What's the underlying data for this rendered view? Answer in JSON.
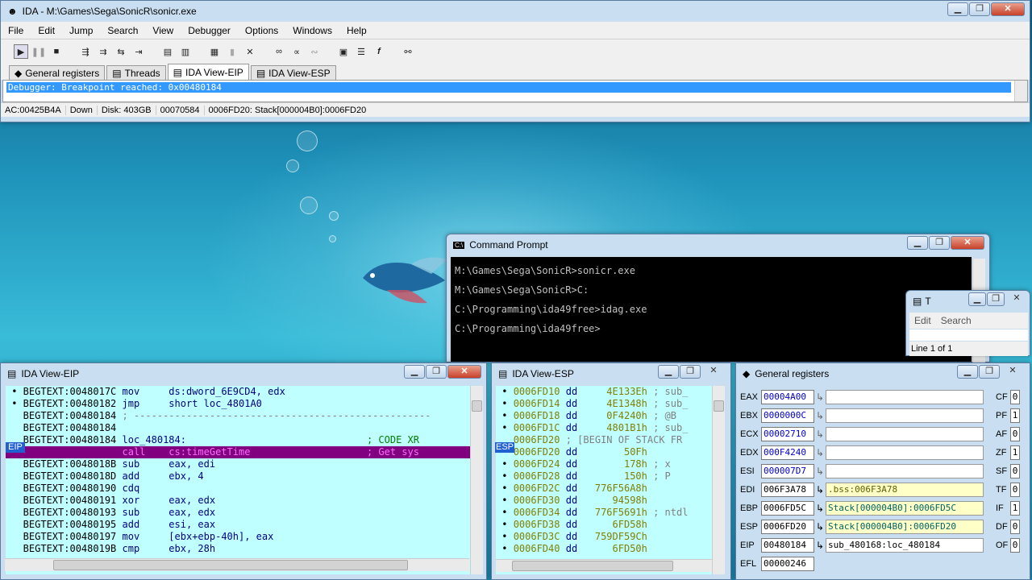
{
  "ida": {
    "title": "IDA - M:\\Games\\Sega\\SonicR\\sonicr.exe",
    "menus": [
      "File",
      "Edit",
      "Jump",
      "Search",
      "View",
      "Debugger",
      "Options",
      "Windows",
      "Help"
    ],
    "tabs": [
      "General registers",
      "Threads",
      "IDA View-EIP",
      "IDA View-ESP"
    ],
    "message": "Debugger: Breakpoint reached: 0x00480184",
    "status": [
      "AC:00425B4A",
      "Down",
      "Disk: 403GB",
      "00070584",
      "0006FD20: Stack[000004B0]:0006FD20"
    ]
  },
  "cmd": {
    "title": "Command Prompt",
    "lines": [
      "M:\\Games\\Sega\\SonicR>sonicr.exe",
      "M:\\Games\\Sega\\SonicR>C:",
      "C:\\Programming\\ida49free>idag.exe",
      "C:\\Programming\\ida49free>"
    ]
  },
  "threads": {
    "title": "T",
    "menu": [
      "Edit",
      "Search"
    ],
    "status": "Line 1 of 1"
  },
  "eip_view": {
    "title": "IDA View-EIP",
    "marker": "EIP",
    "lines": [
      {
        "addr": "BEGTEXT:0048017C",
        "mn": "mov",
        "op": "ds:dword_6E9CD4, edx",
        "cm": ""
      },
      {
        "addr": "BEGTEXT:00480182",
        "mn": "jmp",
        "op": "short loc_4801A0",
        "cm": ""
      },
      {
        "addr": "BEGTEXT:00480184",
        "mn": ";",
        "op": "---------------------------------------------------",
        "cm": ""
      },
      {
        "addr": "BEGTEXT:00480184",
        "mn": "",
        "op": "",
        "cm": ""
      },
      {
        "addr": "BEGTEXT:00480184",
        "mn": "loc_480184:",
        "op": "",
        "cm": "; CODE XR"
      },
      {
        "addr": "BEGTEXT:00480184",
        "mn": "call",
        "op": "cs:timeGetTime",
        "cm": "; Get sys"
      },
      {
        "addr": "BEGTEXT:0048018B",
        "mn": "sub",
        "op": "eax, edi",
        "cm": ""
      },
      {
        "addr": "BEGTEXT:0048018D",
        "mn": "add",
        "op": "ebx, 4",
        "cm": ""
      },
      {
        "addr": "BEGTEXT:00480190",
        "mn": "cdq",
        "op": "",
        "cm": ""
      },
      {
        "addr": "BEGTEXT:00480191",
        "mn": "xor",
        "op": "eax, edx",
        "cm": ""
      },
      {
        "addr": "BEGTEXT:00480193",
        "mn": "sub",
        "op": "eax, edx",
        "cm": ""
      },
      {
        "addr": "BEGTEXT:00480195",
        "mn": "add",
        "op": "esi, eax",
        "cm": ""
      },
      {
        "addr": "BEGTEXT:00480197",
        "mn": "mov",
        "op": "[ebx+ebp-40h], eax",
        "cm": ""
      },
      {
        "addr": "BEGTEXT:0048019B",
        "mn": "cmp",
        "op": "ebx, 28h",
        "cm": ""
      }
    ]
  },
  "esp_view": {
    "title": "IDA View-ESP",
    "marker": "ESP",
    "lines": [
      {
        "addr": "0006FD10",
        "mn": "dd",
        "val": "4E133Eh",
        "cm": "; sub_"
      },
      {
        "addr": "0006FD14",
        "mn": "dd",
        "val": "4E1348h",
        "cm": "; sub_"
      },
      {
        "addr": "0006FD18",
        "mn": "dd",
        "val": "0F4240h",
        "cm": "; @B"
      },
      {
        "addr": "0006FD1C",
        "mn": "dd",
        "val": "4801B1h",
        "cm": "; sub_"
      },
      {
        "addr": "0006FD20",
        "mn": ";",
        "val": "",
        "cm": "[BEGIN OF STACK FR"
      },
      {
        "addr": "0006FD20",
        "mn": "dd",
        "val": "50Fh",
        "cm": ""
      },
      {
        "addr": "0006FD24",
        "mn": "dd",
        "val": "178h",
        "cm": "; x"
      },
      {
        "addr": "0006FD28",
        "mn": "dd",
        "val": "150h",
        "cm": "; P"
      },
      {
        "addr": "0006FD2C",
        "mn": "dd",
        "val": "776F56A8h",
        "cm": ""
      },
      {
        "addr": "0006FD30",
        "mn": "dd",
        "val": "94598h",
        "cm": ""
      },
      {
        "addr": "0006FD34",
        "mn": "dd",
        "val": "776F5691h",
        "cm": "; ntdl"
      },
      {
        "addr": "0006FD38",
        "mn": "dd",
        "val": "6FD58h",
        "cm": ""
      },
      {
        "addr": "0006FD3C",
        "mn": "dd",
        "val": "759DF59Ch",
        "cm": ""
      },
      {
        "addr": "0006FD40",
        "mn": "dd",
        "val": "6FD50h",
        "cm": ""
      }
    ]
  },
  "registers": {
    "title": "General registers",
    "regs": [
      {
        "name": "EAX",
        "val": "00004A00",
        "desc": ""
      },
      {
        "name": "EBX",
        "val": "0000000C",
        "desc": ""
      },
      {
        "name": "ECX",
        "val": "00002710",
        "desc": ""
      },
      {
        "name": "EDX",
        "val": "000F4240",
        "desc": ""
      },
      {
        "name": "ESI",
        "val": "000007D7",
        "desc": ""
      },
      {
        "name": "EDI",
        "val": "006F3A78",
        "desc": ".bss:006F3A78"
      },
      {
        "name": "EBP",
        "val": "0006FD5C",
        "desc": "Stack[000004B0]:0006FD5C"
      },
      {
        "name": "ESP",
        "val": "0006FD20",
        "desc": "Stack[000004B0]:0006FD20"
      },
      {
        "name": "EIP",
        "val": "00480184",
        "desc": "sub_480168:loc_480184"
      },
      {
        "name": "EFL",
        "val": "00000246",
        "desc": ""
      }
    ],
    "flags": [
      {
        "name": "CF",
        "val": "0"
      },
      {
        "name": "PF",
        "val": "1"
      },
      {
        "name": "AF",
        "val": "0"
      },
      {
        "name": "ZF",
        "val": "1"
      },
      {
        "name": "SF",
        "val": "0"
      },
      {
        "name": "TF",
        "val": "0"
      },
      {
        "name": "IF",
        "val": "1"
      },
      {
        "name": "DF",
        "val": "0"
      },
      {
        "name": "OF",
        "val": "0"
      }
    ]
  }
}
